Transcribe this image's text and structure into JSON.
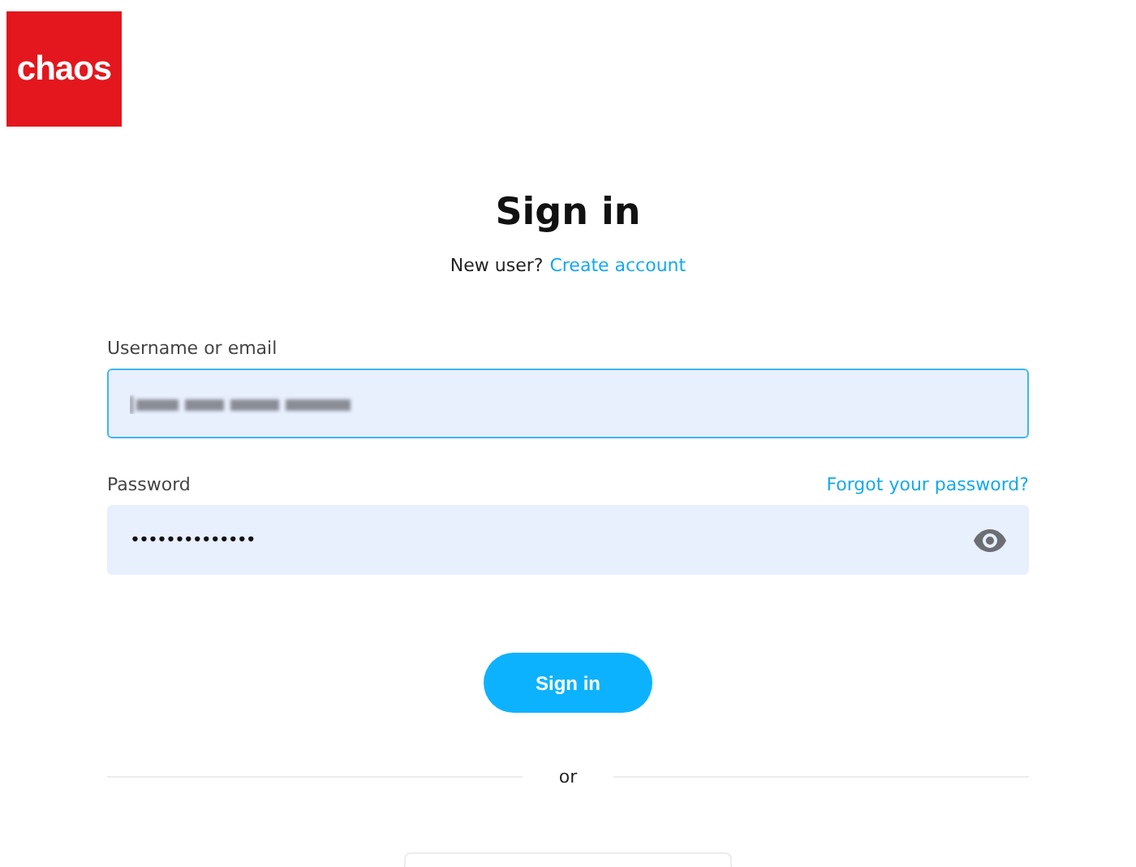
{
  "logo": {
    "text": "chaos"
  },
  "title": "Sign in",
  "signup_prompt": {
    "text": "New user?",
    "link": "Create account"
  },
  "username": {
    "label": "Username or email",
    "focused": true
  },
  "password": {
    "label": "Password",
    "forgot_link": "Forgot your password?",
    "value": "••••••••••••••",
    "focused": false
  },
  "submit": "Sign in",
  "divider": "or"
}
